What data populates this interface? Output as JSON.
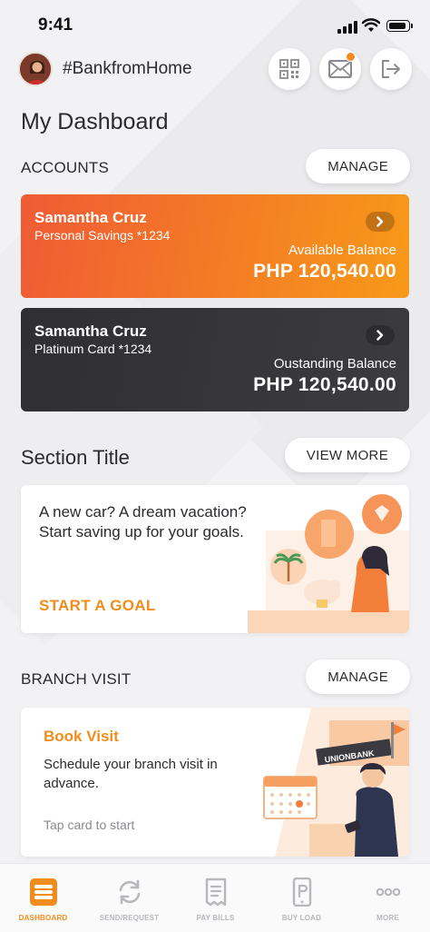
{
  "status_bar": {
    "time": "9:41"
  },
  "header": {
    "title": "#BankfromHome",
    "icons": [
      "qr-code-icon",
      "mail-icon",
      "logout-icon"
    ]
  },
  "page_title": "My Dashboard",
  "accounts": {
    "label": "ACCOUNTS",
    "manage_label": "MANAGE",
    "cards": [
      {
        "name": "Samantha Cruz",
        "type": "Personal Savings *1234",
        "balance_label": "Available Balance",
        "balance": "PHP 120,540.00"
      },
      {
        "name": "Samantha Cruz",
        "type": "Platinum Card *1234",
        "balance_label": "Oustanding Balance",
        "balance": "PHP 120,540.00"
      }
    ]
  },
  "goals_section": {
    "title": "Section Title",
    "view_more_label": "VIEW MORE",
    "card_text": "A new car? A dream vacation? Start saving up for your goals.",
    "cta": "START A GOAL"
  },
  "branch_visit": {
    "label": "BRANCH VISIT",
    "manage_label": "MANAGE",
    "card_title": "Book Visit",
    "card_desc": "Schedule your branch visit in advance.",
    "card_hint": "Tap card to start",
    "bank_sign": "UNIONBANK"
  },
  "tabs": [
    {
      "label": "DASHBOARD",
      "icon": "dashboard-icon",
      "active": true
    },
    {
      "label": "SEND/REQUEST",
      "icon": "sync-icon",
      "active": false
    },
    {
      "label": "PAY BILLS",
      "icon": "receipt-icon",
      "active": false
    },
    {
      "label": "BUY LOAD",
      "icon": "phone-load-icon",
      "active": false
    },
    {
      "label": "MORE",
      "icon": "more-icon",
      "active": false
    }
  ],
  "colors": {
    "accent": "#f28c1c",
    "orange_card_start": "#ef5b35",
    "orange_card_end": "#f79a18",
    "dark_card": "#333338",
    "background": "#f2f2f4"
  }
}
